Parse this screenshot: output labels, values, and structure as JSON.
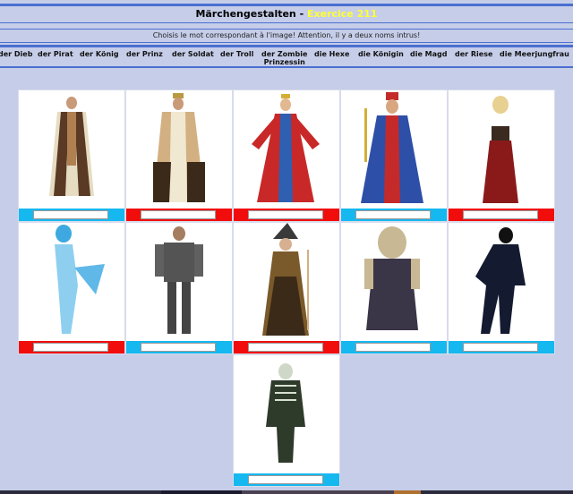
{
  "header": {
    "title": "Märchengestalten - ",
    "exercise": "Exercice 211",
    "instruction": "Choisis le mot correspondant à l'image! Attention, il y a deux noms intrus!"
  },
  "words": [
    {
      "label": "der Dieb"
    },
    {
      "label": "der Pirat"
    },
    {
      "label": "der König"
    },
    {
      "label": "der Prinz"
    },
    {
      "label": "der Soldat"
    },
    {
      "label": "der Troll"
    },
    {
      "label": "der Zombie\nPrinzessin"
    },
    {
      "label": "die Hexe"
    },
    {
      "label": "die Königin"
    },
    {
      "label": "die Magd"
    },
    {
      "label": "der Riese"
    },
    {
      "label": "die Meerjungfrau"
    }
  ],
  "cards": [
    {
      "image": "robed-man-costume",
      "answer": "",
      "flag": "blue"
    },
    {
      "image": "king-costume-cape",
      "answer": "",
      "flag": "red"
    },
    {
      "image": "queen-red-gown",
      "answer": "",
      "flag": "red"
    },
    {
      "image": "king-blue-robe",
      "answer": "",
      "flag": "blue"
    },
    {
      "image": "maid-red-skirt",
      "answer": "",
      "flag": "red"
    },
    {
      "image": "mermaid-costume",
      "answer": "",
      "flag": "red"
    },
    {
      "image": "soldier-armor",
      "answer": "",
      "flag": "blue"
    },
    {
      "image": "witch-costume",
      "answer": "",
      "flag": "red"
    },
    {
      "image": "troll-mask-costume",
      "answer": "",
      "flag": "blue"
    },
    {
      "image": "thief-black-suit",
      "answer": "",
      "flag": "blue"
    },
    {
      "image": "zombie-costume",
      "answer": "",
      "flag": "blue"
    }
  ]
}
